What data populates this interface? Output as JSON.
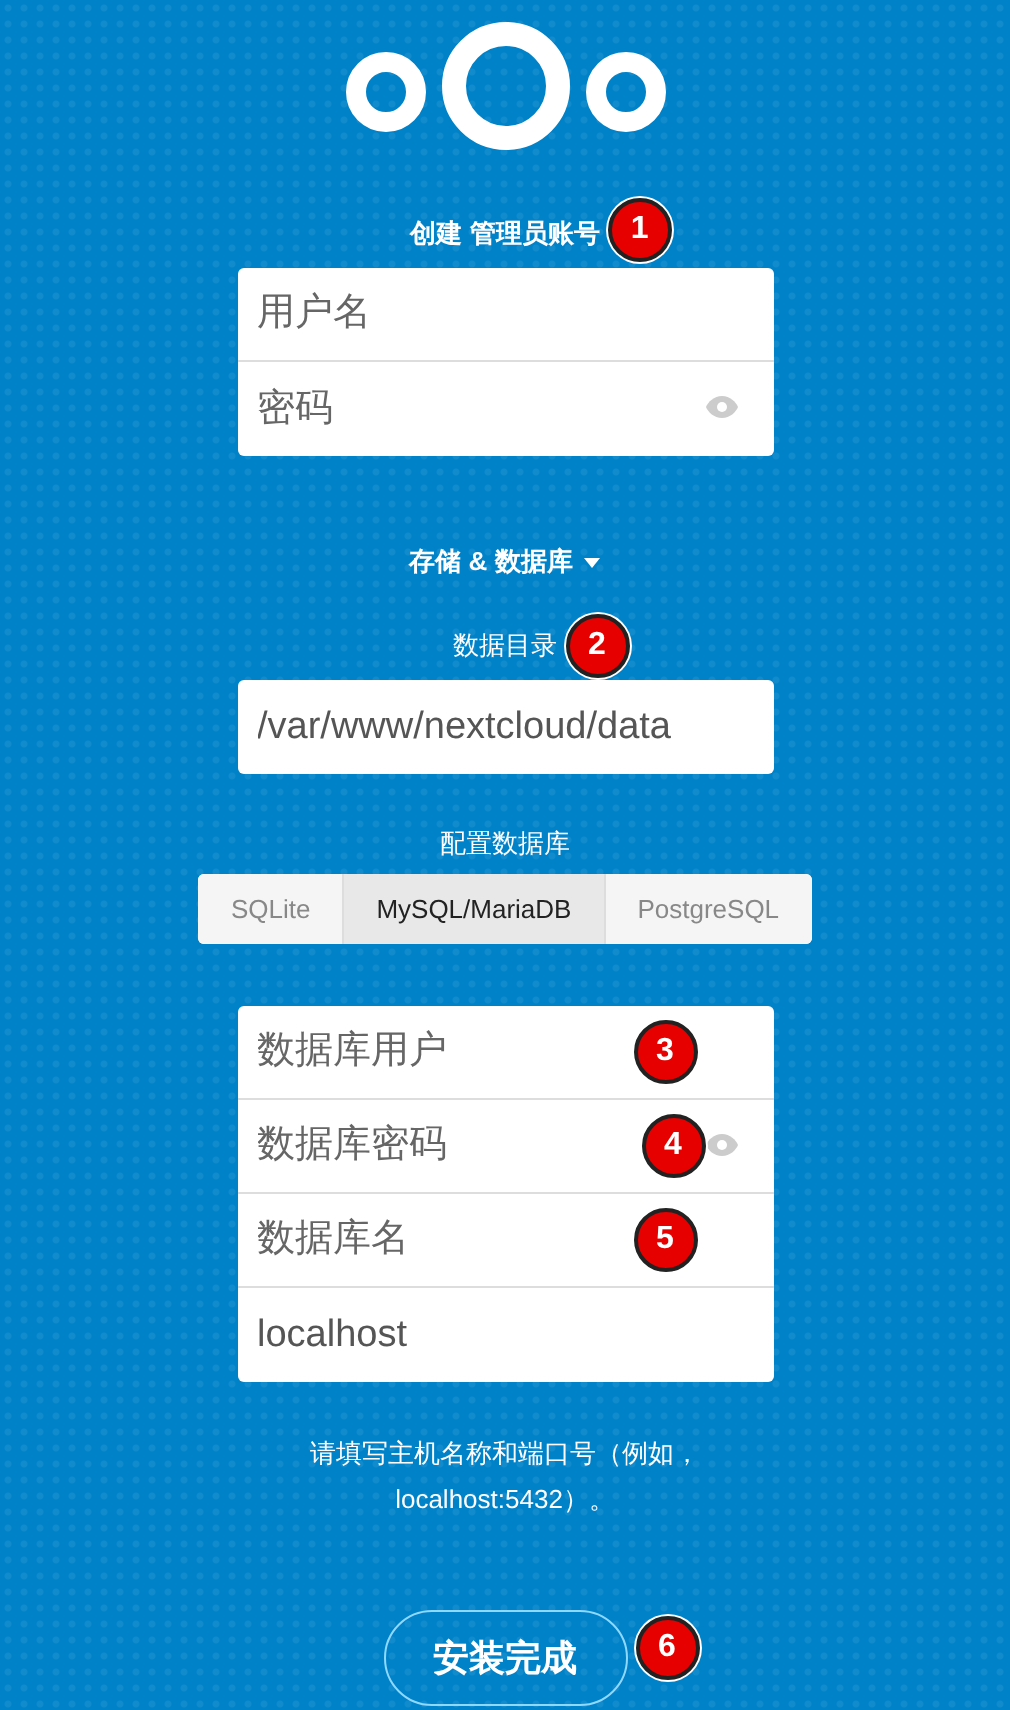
{
  "admin": {
    "label": "创建 管理员账号",
    "badge": "1",
    "fields": [
      {
        "kind": "text",
        "placeholder": "用户名"
      },
      {
        "kind": "password",
        "placeholder": "密码"
      }
    ]
  },
  "storage_toggle": {
    "label": "存储 & 数据库"
  },
  "data_dir": {
    "label": "数据目录",
    "badge": "2",
    "value": "/var/www/nextcloud/data"
  },
  "database": {
    "label": "配置数据库",
    "tabs": [
      {
        "label": "SQLite",
        "selected": false
      },
      {
        "label": "MySQL/MariaDB",
        "selected": true
      },
      {
        "label": "PostgreSQL",
        "selected": false
      }
    ],
    "fields": [
      {
        "kind": "text",
        "placeholder": "数据库用户",
        "badge": "3"
      },
      {
        "kind": "password",
        "placeholder": "数据库密码",
        "badge": "4"
      },
      {
        "kind": "text",
        "placeholder": "数据库名",
        "badge": "5"
      },
      {
        "kind": "text",
        "value": "localhost"
      }
    ],
    "hint": "请填写主机名称和端口号（例如，localhost:5432）。"
  },
  "submit": {
    "label": "安装完成",
    "badge": "6"
  }
}
